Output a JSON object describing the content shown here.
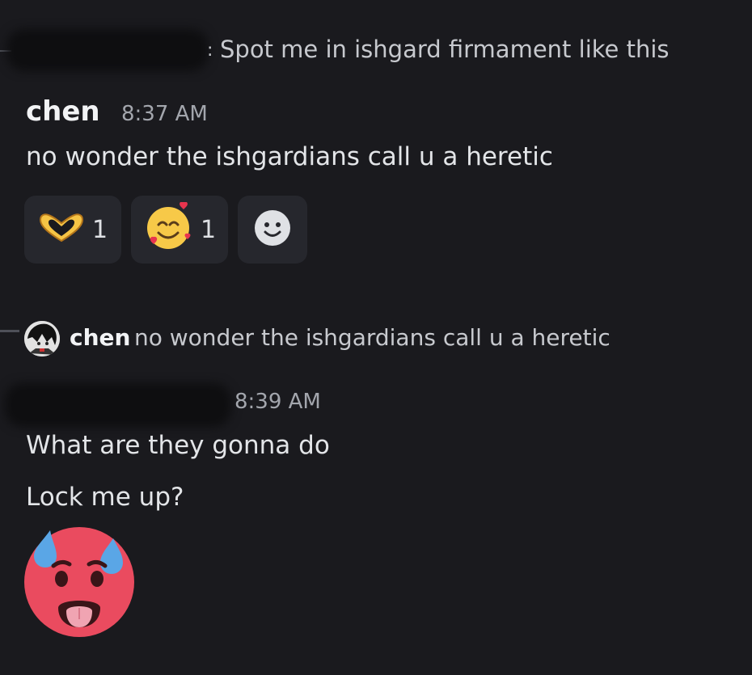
{
  "reply_preview": {
    "author": "",
    "text": "Spot me in ishgard firmament like this"
  },
  "message1": {
    "author": "chen",
    "timestamp": "8:37 AM",
    "text": "no wonder the ishgardians call u a heretic",
    "reactions": [
      {
        "emoji": "heart-hands-icon",
        "count": "1"
      },
      {
        "emoji": "smiling-face-with-hearts-icon",
        "count": "1"
      }
    ],
    "add_reaction_icon": "add-reaction-icon"
  },
  "reply_preview2": {
    "author": "chen",
    "text": "no wonder the ishgardians call u a heretic"
  },
  "message2": {
    "author": "",
    "timestamp": "8:39 AM",
    "lines": [
      "What are they gonna do",
      "Lock me up?"
    ],
    "emoji": "hot-face-icon"
  },
  "colors": {
    "background": "#1a1a1e",
    "reaction_bg": "#26272d",
    "text": "#e3e5e8",
    "muted": "#a3a6ad"
  }
}
